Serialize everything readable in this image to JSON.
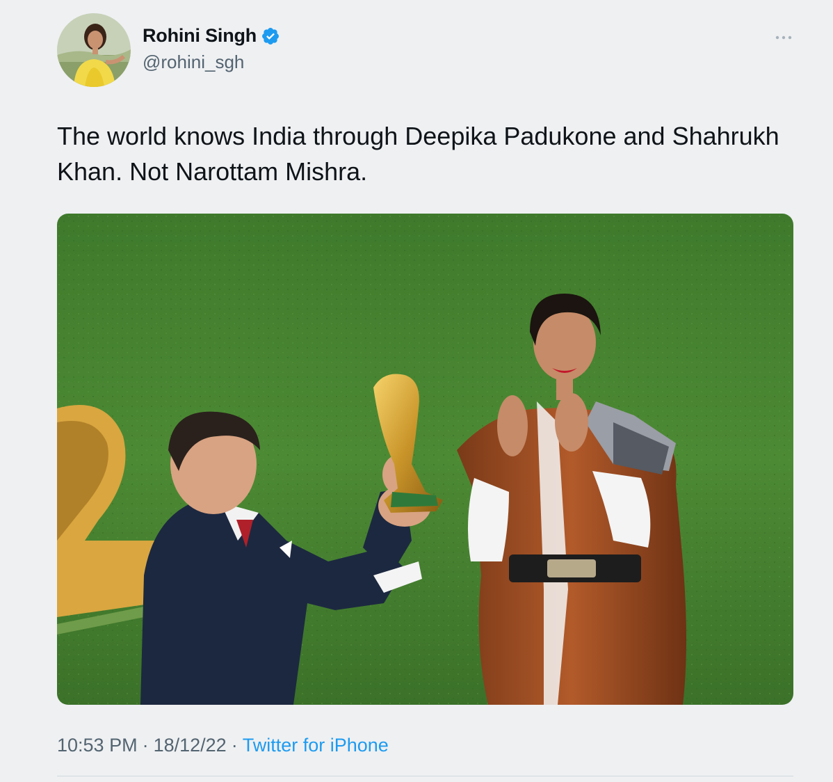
{
  "tweet": {
    "author": {
      "display_name": "Rohini Singh",
      "handle": "@rohini_sgh",
      "verified": true
    },
    "text": "The world knows India through Deepika Padukone and Shahrukh Khan. Not Narottam Mishra.",
    "timestamp": {
      "time": "10:53 PM",
      "separator": "·",
      "date": "18/12/22",
      "source": "Twitter for iPhone"
    },
    "icons": {
      "verified": "verified-badge-icon",
      "more": "more-options-icon"
    }
  },
  "colors": {
    "background": "#eff0f2",
    "text_primary": "#0f1419",
    "text_secondary": "#536471",
    "link": "#1d9bf0",
    "verified": "#1d9bf0"
  }
}
